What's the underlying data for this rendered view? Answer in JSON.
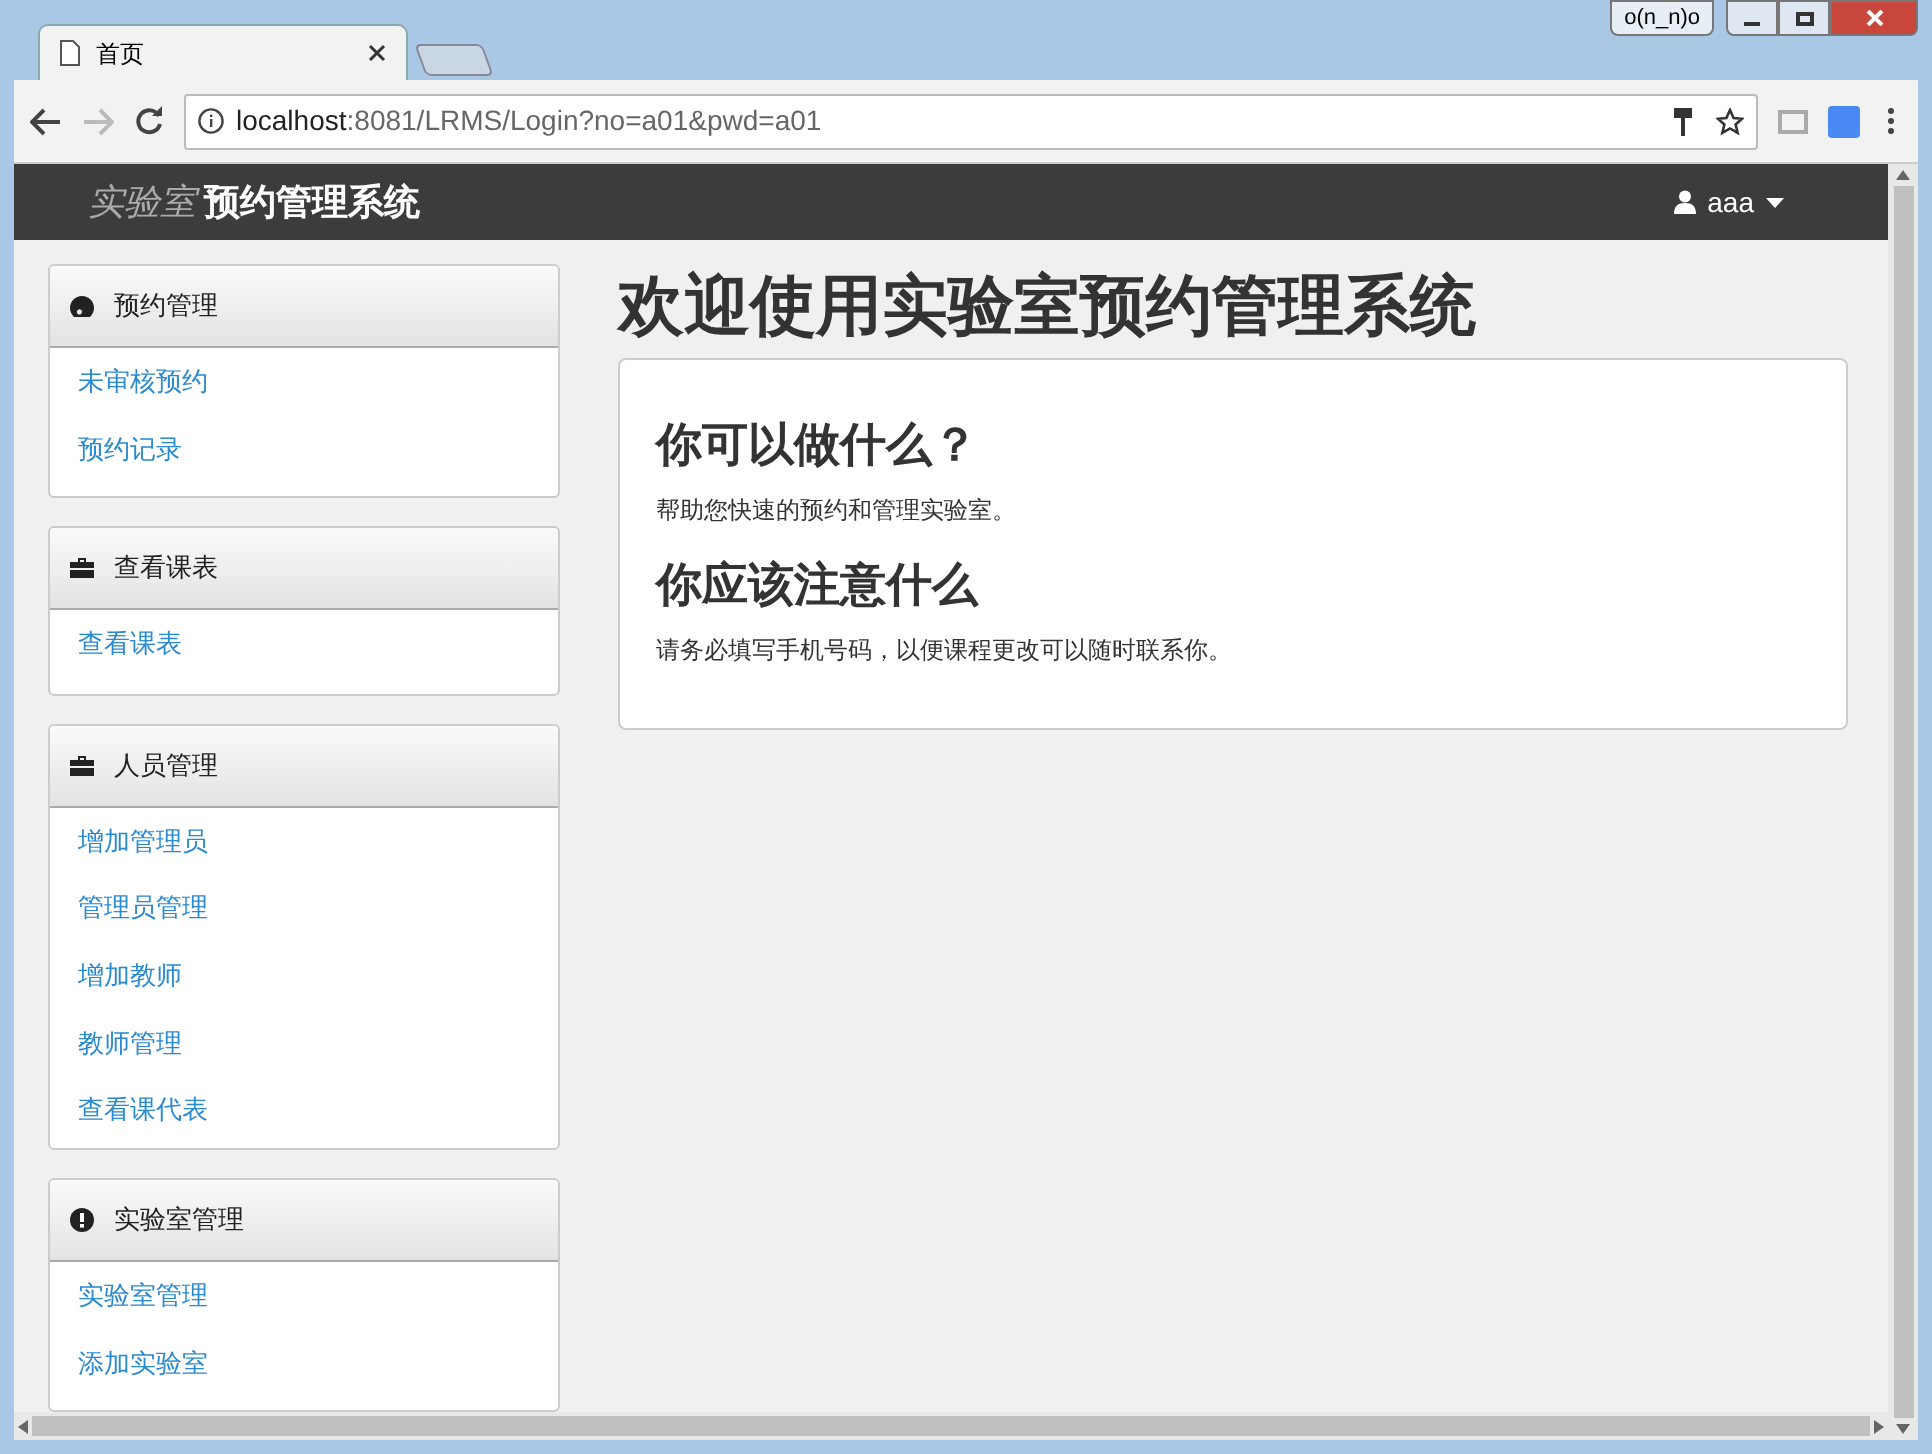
{
  "window": {
    "badge": "o(n_n)o"
  },
  "tabs": [
    {
      "title": "首页",
      "selected": true
    },
    {
      "selected": false
    }
  ],
  "address_bar": {
    "host": "localhost",
    "rest": ":8081/LRMS/Login?no=a01&pwd=a01"
  },
  "navbar": {
    "brand_light": "实验室",
    "brand_bold": "预约管理系统",
    "user": "aaa"
  },
  "sidebar": {
    "panels": [
      {
        "title": "预约管理",
        "links": [
          "未审核预约",
          "预约记录"
        ]
      },
      {
        "title": "查看课表",
        "links": [
          "查看课表"
        ]
      },
      {
        "title": "人员管理",
        "links": [
          "增加管理员",
          "管理员管理",
          "增加教师",
          "教师管理",
          "查看课代表"
        ]
      },
      {
        "title": "实验室管理",
        "links": [
          "实验室管理",
          "添加实验室"
        ]
      }
    ]
  },
  "main": {
    "title": "欢迎使用实验室预约管理系统",
    "sections": [
      {
        "heading": "你可以做什么？",
        "text": "帮助您快速的预约和管理实验室。"
      },
      {
        "heading": "你应该注意什么",
        "text": "请务必填写手机号码，以便课程更改可以随时联系你。"
      }
    ]
  }
}
